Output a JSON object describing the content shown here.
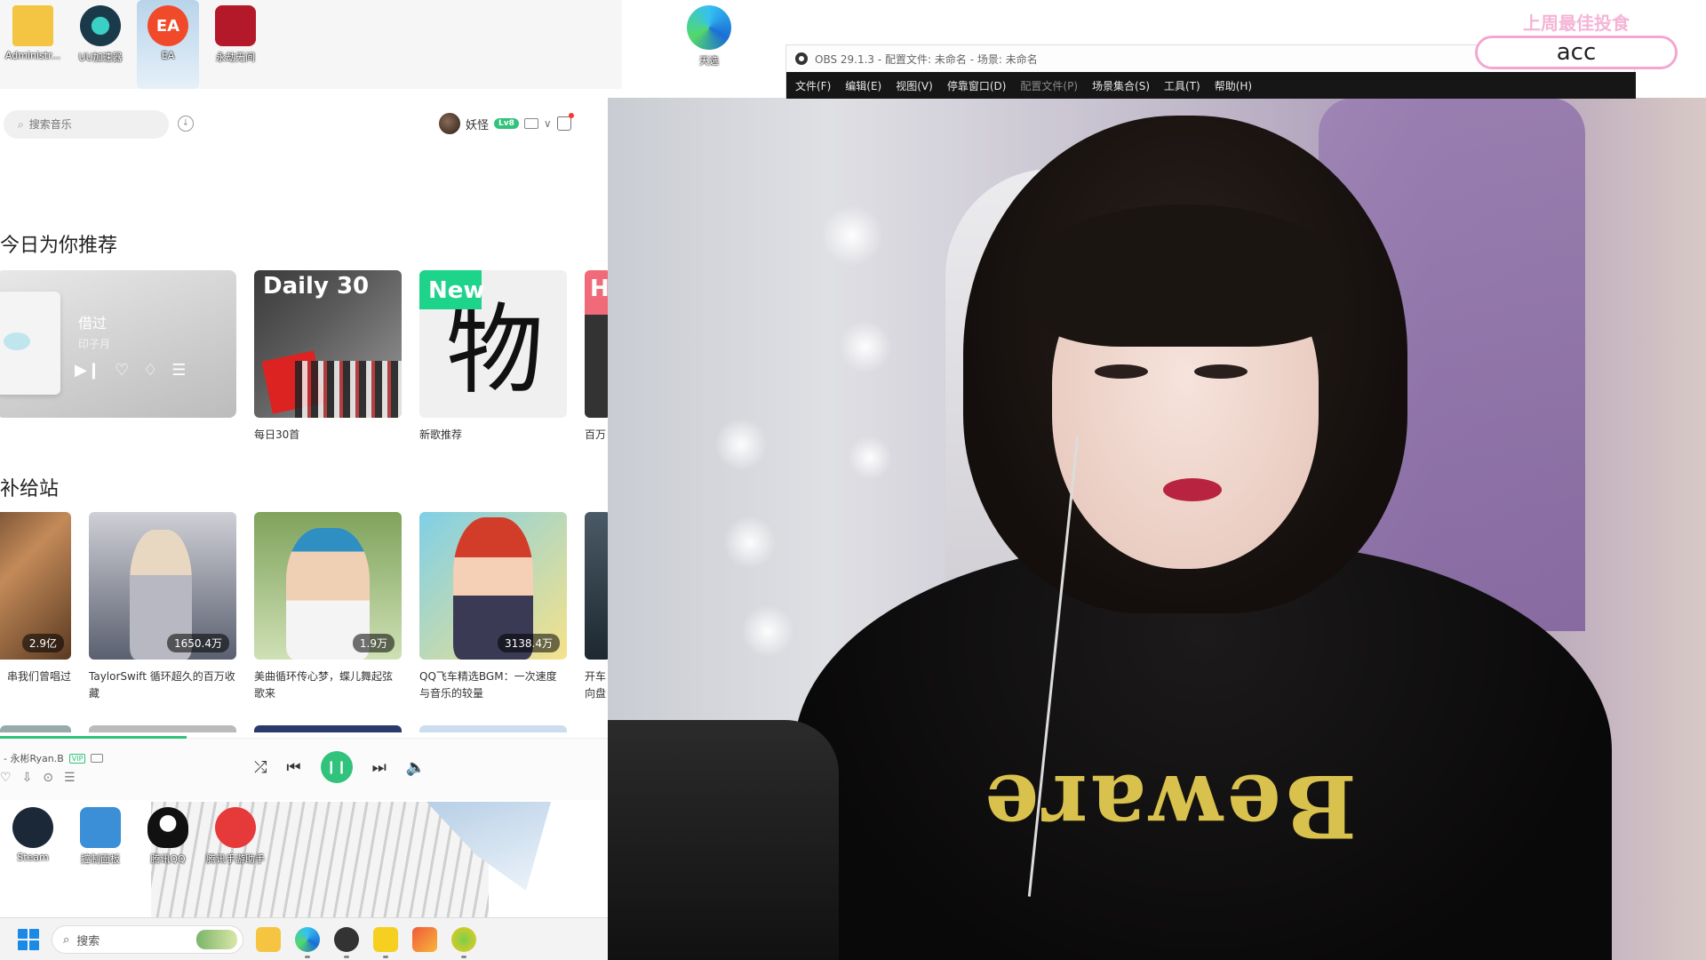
{
  "desktop_top": {
    "icons": [
      {
        "label": "Administr...",
        "icon": "folder-icon",
        "color": "#f4c542"
      },
      {
        "label": "UU加速器",
        "icon": "uu-accelerator-icon",
        "color": "#1a3a4a"
      },
      {
        "label": "EA",
        "icon": "ea-icon",
        "color": "#f04a2a"
      },
      {
        "label": "永劫无间",
        "icon": "naraka-icon",
        "color": "#b4192a"
      }
    ],
    "edge_label": "天选"
  },
  "music": {
    "search_placeholder": "搜索音乐",
    "username": "妖怪",
    "vip_badge": "Lv8",
    "section_recommend": "今日为你推荐",
    "now_playing": {
      "title": "借过",
      "artist": "印子月"
    },
    "tiles": [
      {
        "cover_text": "Daily 30",
        "label": "每日30首"
      },
      {
        "cover_text": "New",
        "label": "新歌推荐"
      },
      {
        "cover_text": "H",
        "label": "百万"
      }
    ],
    "section_station": "补给站",
    "playlists": [
      {
        "count": "2.9亿",
        "label": "串我们曾唱过"
      },
      {
        "count": "1650.4万",
        "label": "TaylorSwift 循环超久的百万收藏"
      },
      {
        "count": "1.9万",
        "label": "美曲循环传心梦，蝶儿舞起弦歌来"
      },
      {
        "count": "3138.4万",
        "label": "QQ飞车精选BGM：一次速度与音乐的较量"
      },
      {
        "count": "",
        "label": "开车向盘"
      }
    ],
    "player": {
      "song": "- 永彬Ryan.B",
      "vip_tag": "VIP"
    },
    "accent": "#31c27c"
  },
  "desktop_bottom": {
    "icons": [
      {
        "label": "Steam",
        "icon": "steam-icon",
        "color": "#1b2838"
      },
      {
        "label": "控制面板",
        "icon": "control-panel-icon",
        "color": "#3a8fd6"
      },
      {
        "label": "腾讯QQ",
        "icon": "qq-icon",
        "color": "#111111"
      },
      {
        "label": "腾讯手游助手",
        "icon": "tencent-game-assistant-icon",
        "color": "#e63a3a"
      }
    ]
  },
  "taskbar": {
    "search_label": "搜索"
  },
  "obs": {
    "title": "OBS 29.1.3 - 配置文件: 未命名 - 场景: 未命名",
    "menu": [
      "文件(F)",
      "编辑(E)",
      "视图(V)",
      "停靠窗口(D)",
      "配置文件(P)",
      "场景集合(S)",
      "工具(T)",
      "帮助(H)"
    ]
  },
  "overlay": {
    "title": "上周最佳投食",
    "name": "acc"
  }
}
